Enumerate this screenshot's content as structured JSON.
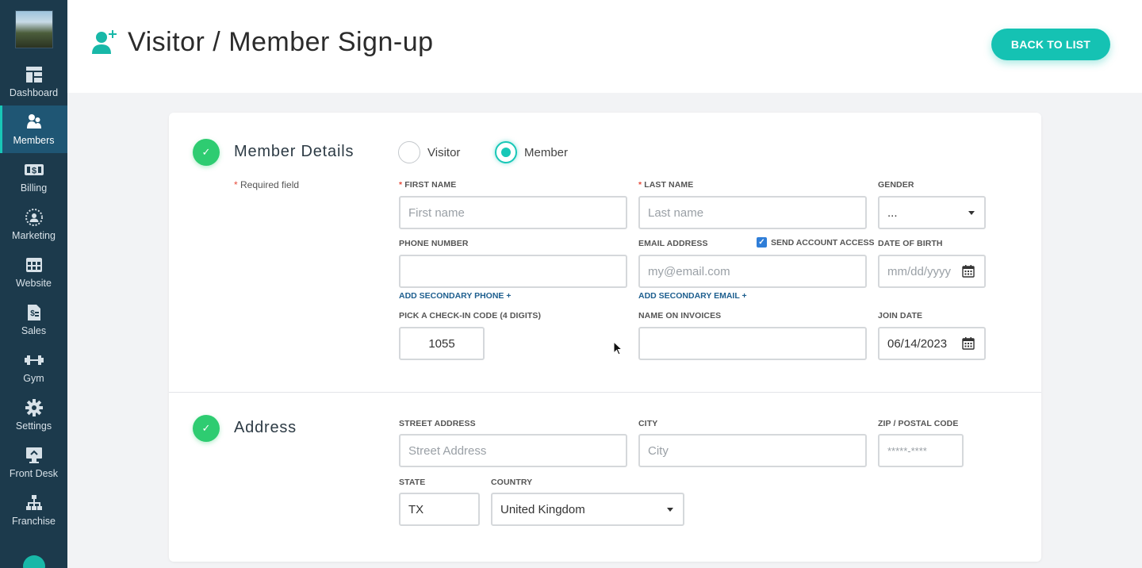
{
  "sidebar": {
    "items": [
      {
        "label": "Dashboard",
        "icon": "dashboard-icon"
      },
      {
        "label": "Members",
        "icon": "members-icon",
        "active": true
      },
      {
        "label": "Billing",
        "icon": "billing-icon"
      },
      {
        "label": "Marketing",
        "icon": "marketing-icon"
      },
      {
        "label": "Website",
        "icon": "website-icon"
      },
      {
        "label": "Sales",
        "icon": "sales-icon"
      },
      {
        "label": "Gym",
        "icon": "dumbbell-icon"
      },
      {
        "label": "Settings",
        "icon": "gear-icon"
      },
      {
        "label": "Front Desk",
        "icon": "front-desk-icon"
      },
      {
        "label": "Franchise",
        "icon": "franchise-icon"
      }
    ]
  },
  "header": {
    "title": "Visitor / Member Sign-up",
    "back_label": "BACK TO LIST"
  },
  "colors": {
    "accent": "#15c2b3",
    "sidebar": "#1c3a4c",
    "success": "#2ecc71",
    "link": "#1e5f8f"
  },
  "member_details": {
    "title": "Member Details",
    "required_note": "Required field",
    "required_star": "*",
    "type_options": [
      "Visitor",
      "Member"
    ],
    "selected_type": "Member",
    "first_name": {
      "label": "FIRST NAME",
      "placeholder": "First name",
      "value": ""
    },
    "last_name": {
      "label": "LAST NAME",
      "placeholder": "Last name",
      "value": ""
    },
    "gender": {
      "label": "GENDER",
      "value": "..."
    },
    "phone": {
      "label": "PHONE NUMBER",
      "value": "",
      "add_label": "ADD SECONDARY PHONE +"
    },
    "email": {
      "label": "EMAIL ADDRESS",
      "placeholder": "my@email.com",
      "add_label": "ADD SECONDARY EMAIL +"
    },
    "send_access": {
      "label": "SEND ACCOUNT ACCESS",
      "checked": true
    },
    "dob": {
      "label": "DATE OF BIRTH",
      "placeholder": "mm/dd/yyyy"
    },
    "checkin_code": {
      "label": "PICK A CHECK-IN CODE (4 DIGITS)",
      "value": "1055"
    },
    "invoice_name": {
      "label": "NAME ON INVOICES",
      "value": ""
    },
    "join_date": {
      "label": "JOIN DATE",
      "value": "06/14/2023"
    }
  },
  "address": {
    "title": "Address",
    "street": {
      "label": "STREET ADDRESS",
      "placeholder": "Street Address"
    },
    "city": {
      "label": "CITY",
      "placeholder": "City"
    },
    "zip": {
      "label": "ZIP / POSTAL CODE",
      "placeholder": "*****-****"
    },
    "state": {
      "label": "STATE",
      "value": "TX"
    },
    "country": {
      "label": "COUNTRY",
      "value": "United Kingdom"
    }
  }
}
